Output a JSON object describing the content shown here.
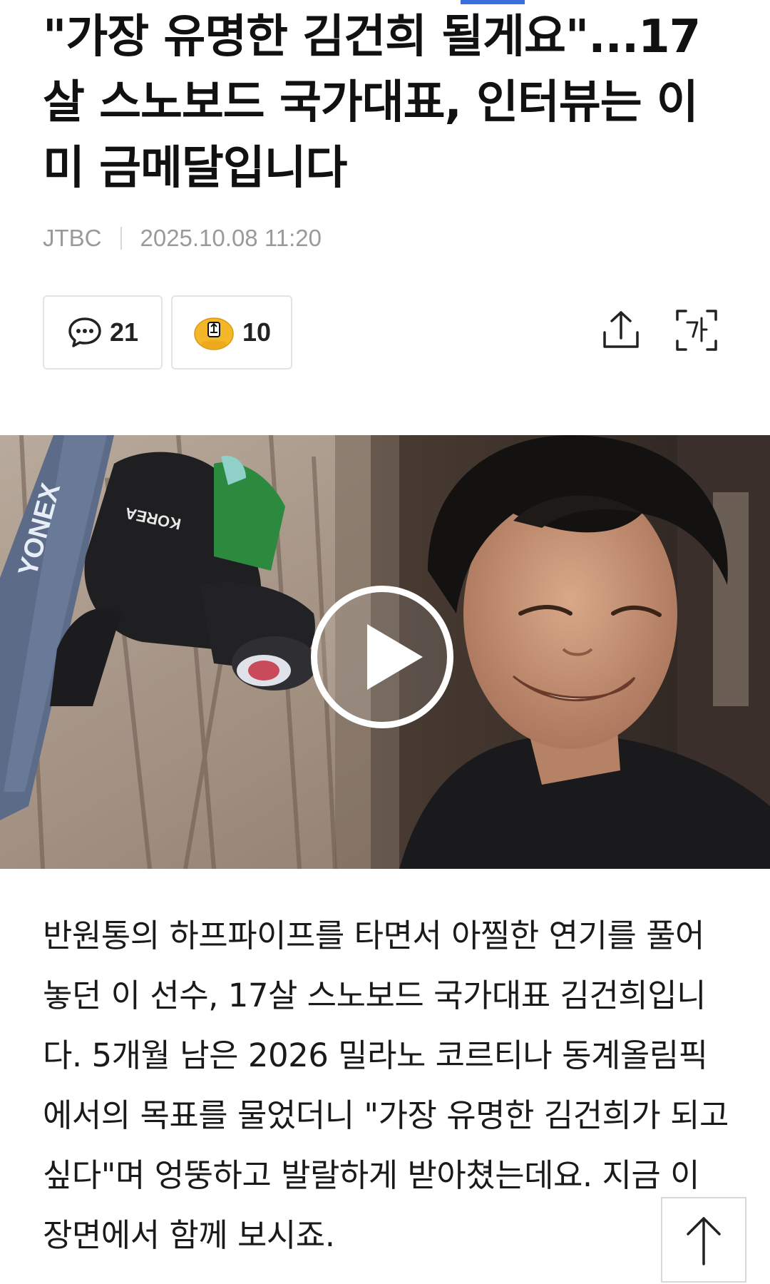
{
  "article": {
    "headline": "\"가장 유명한 김건희 될게요\"...17살 스노보드 국가대표, 인터뷰는 이미 금메달입니다",
    "source": "JTBC",
    "datetime": "2025.10.08 11:20",
    "comment_count": "21",
    "reaction_count": "10",
    "video_thumbnail": {
      "board_brand": "YONEX",
      "jersey_text": "KOREA"
    },
    "body": "반원통의 하프파이프를 타면서 아찔한 연기를 풀어놓던 이 선수, 17살 스노보드 국가대표 김건희입니다. 5개월 남은 2026 밀라노 코르티나 동계올림픽에서의 목표를 물었더니 \"가장 유명한 김건희가 되고 싶다\"며 엉뚱하고 발랄하게 받아쳤는데요. 지금 이 장면에서 함께 보시죠."
  },
  "icons": {
    "comment": "speech-bubble-icon",
    "reaction": "emoji-face-icon",
    "share": "share-upload-icon",
    "font_size": "font-size-icon",
    "play": "play-icon",
    "scroll_top": "arrow-up-icon"
  },
  "colors": {
    "accent": "#3b6fe0",
    "meta_text": "#9a9a9a",
    "emoji_yellow": "#f5b72a"
  }
}
